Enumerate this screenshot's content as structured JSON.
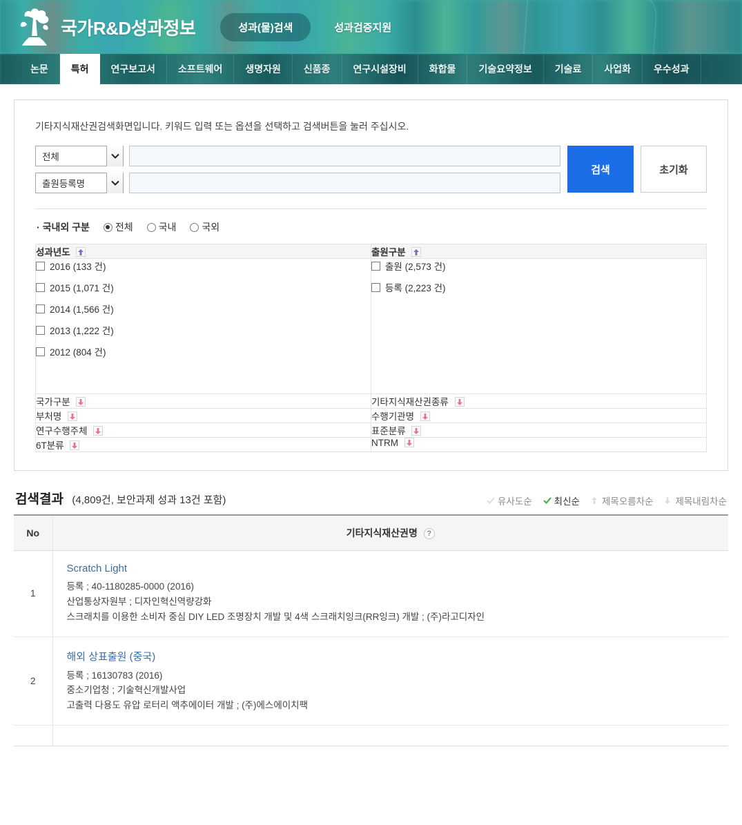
{
  "header": {
    "logo_icon": "tree-logo-icon",
    "title": "국가R&D성과정보",
    "nav": [
      {
        "label": "성과(물)검색",
        "active": true
      },
      {
        "label": "성과검증지원",
        "active": false
      }
    ],
    "bg_color": "#3aada8"
  },
  "tabs": [
    {
      "label": "논문",
      "active": false
    },
    {
      "label": "특허",
      "active": true
    },
    {
      "label": "연구보고서",
      "active": false
    },
    {
      "label": "소프트웨어",
      "active": false
    },
    {
      "label": "생명자원",
      "active": false
    },
    {
      "label": "신품종",
      "active": false
    },
    {
      "label": "연구시설장비",
      "active": false
    },
    {
      "label": "화합물",
      "active": false
    },
    {
      "label": "기술요약정보",
      "active": false
    },
    {
      "label": "기술료",
      "active": false
    },
    {
      "label": "사업화",
      "active": false
    },
    {
      "label": "우수성과",
      "active": false
    }
  ],
  "search": {
    "guide": "기타지식재산권검색화면입니다. 키워드 입력 또는 옵션을 선택하고 검색버튼을 눌러 주십시오.",
    "rows": [
      {
        "select_value": "전체",
        "input_value": "",
        "input_placeholder": ""
      },
      {
        "select_value": "출원등록명",
        "input_value": "",
        "input_placeholder": ""
      }
    ],
    "search_button": "검색",
    "reset_button": "초기화",
    "primary_color": "#1b6ee8"
  },
  "scope": {
    "label": "국내외 구분",
    "options": [
      {
        "label": "전체",
        "selected": true
      },
      {
        "label": "국내",
        "selected": false
      },
      {
        "label": "국외",
        "selected": false
      }
    ]
  },
  "facets": {
    "open": [
      {
        "title": "성과년도",
        "toggle_icon": "collapse-up-icon",
        "items": [
          {
            "label": "2016 (133 건)",
            "checked": false
          },
          {
            "label": "2015 (1,071 건)",
            "checked": false
          },
          {
            "label": "2014 (1,566 건)",
            "checked": false
          },
          {
            "label": "2013 (1,222 건)",
            "checked": false
          },
          {
            "label": "2012 (804 건)",
            "checked": false
          }
        ]
      },
      {
        "title": "출원구분",
        "toggle_icon": "collapse-up-icon",
        "items": [
          {
            "label": "출원 (2,573 건)",
            "checked": false
          },
          {
            "label": "등록 (2,223 건)",
            "checked": false
          }
        ]
      }
    ],
    "collapsed": [
      {
        "left": "국가구분",
        "right": "기타지식재산권종류"
      },
      {
        "left": "부처명",
        "right": "수행기관명"
      },
      {
        "left": "연구수행주체",
        "right": "표준분류"
      },
      {
        "left": "6T분류",
        "right": "NTRM"
      }
    ],
    "expand_icon": "expand-down-icon"
  },
  "results": {
    "title": "검색결과",
    "count_text": "(4,809건, 보안과제 성과 13건 포함)",
    "sorts": [
      {
        "label": "유사도순",
        "active": false,
        "icon": "check-icon"
      },
      {
        "label": "최신순",
        "active": true,
        "icon": "check-icon"
      },
      {
        "label": "제목오름차순",
        "active": false,
        "icon": "arrow-up-icon"
      },
      {
        "label": "제목내림차순",
        "active": false,
        "icon": "arrow-down-icon"
      }
    ],
    "columns": {
      "no": "No",
      "name": "기타지식재산권명",
      "help_icon": "?"
    },
    "rows": [
      {
        "no": "1",
        "title": "Scratch Light",
        "reg": "등록 ; 40-1180285-0000 (2016)",
        "org": "산업통상자원부 ; 디자인혁신역량강화",
        "project": "스크래치를 이용한 소비자 중심 DIY LED 조명장치 개발 및 4색 스크래치잉크(RR잉크) 개발 ; (주)라고디자인"
      },
      {
        "no": "2",
        "title": "해외 상표출원 (중국)",
        "reg": "등록 ; 16130783 (2016)",
        "org": "중소기업청 ; 기술혁신개발사업",
        "project": "고출력 다용도 유압 로터리 액추에이터 개발 ; (주)에스에이치팩"
      }
    ]
  }
}
